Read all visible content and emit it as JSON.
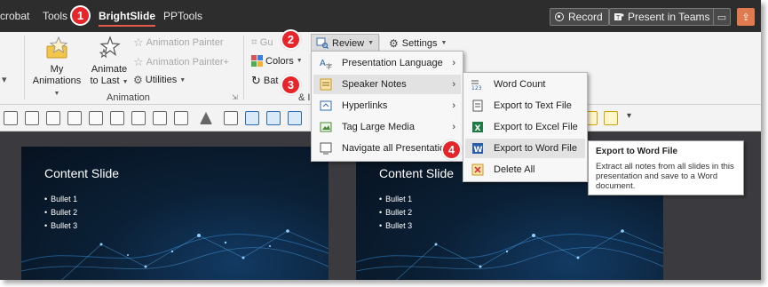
{
  "tabs": {
    "acrobat": "crobat",
    "tools": "Tools",
    "brightslide": "BrightSlide",
    "pptools": "PPTools"
  },
  "top_buttons": {
    "record": "Record",
    "present_in_teams": "Present in Teams"
  },
  "ribbon": {
    "my_animations": "My",
    "my_animations_2": "Animations",
    "animate_to_last": "Animate",
    "animate_to_last_2": "to Last",
    "animation_painter": "Animation Painter",
    "animation_painter_plus": "Animation Painter+",
    "utilities": "Utilities",
    "animation_group": "Animation",
    "guides_partial": "Gu",
    "colors": "Colors",
    "batch_partial": "Bat",
    "group_partial": "& I",
    "review": "Review",
    "settings": "Settings"
  },
  "review_menu": [
    {
      "label": "Presentation Language",
      "icon": "language-icon",
      "submenu": true
    },
    {
      "label": "Speaker Notes",
      "icon": "speaker-notes-icon",
      "submenu": true,
      "highlighted": true
    },
    {
      "label": "Hyperlinks",
      "icon": "hyperlinks-icon",
      "submenu": true
    },
    {
      "label": "Tag Large Media",
      "icon": "tag-media-icon",
      "submenu": true
    },
    {
      "label": "Navigate all Presentations",
      "icon": "navigate-icon",
      "submenu": false
    }
  ],
  "speaker_notes_menu": [
    {
      "label": "Word Count",
      "icon": "word-count-icon"
    },
    {
      "label": "Export to Text File",
      "icon": "text-file-icon"
    },
    {
      "label": "Export to Excel File",
      "icon": "excel-icon"
    },
    {
      "label": "Export to Word File",
      "icon": "word-icon",
      "highlighted": true
    },
    {
      "label": "Delete All",
      "icon": "delete-notes-icon"
    }
  ],
  "tooltip": {
    "title": "Export to Word File",
    "body": "Extract all notes from all slides in this presentation and save to a Word document."
  },
  "slides": [
    {
      "title": "Content Slide",
      "bullets": [
        "Bullet 1",
        "Bullet 2",
        "Bullet 3"
      ]
    },
    {
      "title": "Content Slide",
      "bullets": [
        "Bullet 1",
        "Bullet 2",
        "Bullet 3"
      ]
    }
  ],
  "badges": [
    "1",
    "2",
    "3",
    "4"
  ],
  "colors": {
    "badge": "#e5252a",
    "active_tab_underline": "#e55a4a",
    "menu_highlight": "#e2e2e2"
  }
}
